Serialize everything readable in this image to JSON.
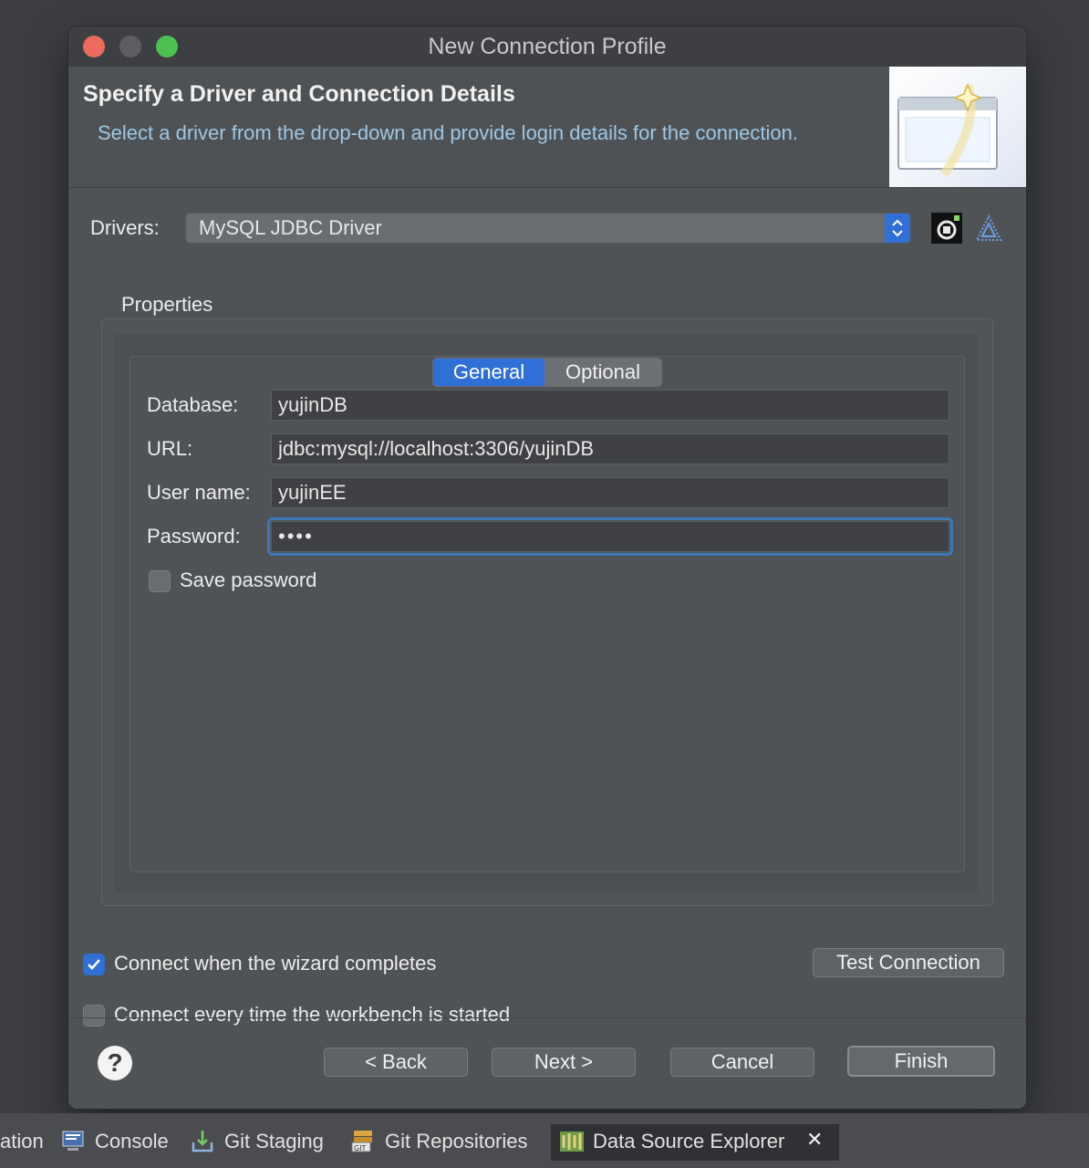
{
  "window": {
    "title": "New Connection Profile"
  },
  "header": {
    "title": "Specify a Driver and Connection Details",
    "description": "Select a driver from the drop-down and provide login details for the connection."
  },
  "drivers": {
    "label": "Drivers:",
    "selected": "MySQL JDBC Driver"
  },
  "properties": {
    "label": "Properties",
    "tabs": [
      "General",
      "Optional"
    ],
    "active_tab": "General",
    "fields": {
      "database": {
        "label": "Database:",
        "value": "yujinDB"
      },
      "url": {
        "label": "URL:",
        "value": "jdbc:mysql://localhost:3306/yujinDB"
      },
      "user": {
        "label": "User name:",
        "value": "yujinEE"
      },
      "password": {
        "label": "Password:",
        "value": "••••"
      }
    },
    "save_password": {
      "label": "Save password",
      "checked": false
    }
  },
  "options": {
    "connect_when_complete": {
      "label": "Connect when the wizard completes",
      "checked": true
    },
    "connect_every_time": {
      "label": "Connect every time the workbench is started",
      "checked": false
    },
    "test_connection": "Test Connection"
  },
  "buttons": {
    "back": "< Back",
    "next": "Next >",
    "cancel": "Cancel",
    "finish": "Finish",
    "help": "?"
  },
  "taskbar": {
    "partial": "ation",
    "items": [
      "Console",
      "Git Staging",
      "Git Repositories",
      "Data Source Explorer"
    ],
    "active": "Data Source Explorer",
    "close_glyph": "✕"
  },
  "colors": {
    "accent": "#2f6fd6",
    "link_text": "#9ec7e6",
    "dialog_bg": "#505356"
  }
}
